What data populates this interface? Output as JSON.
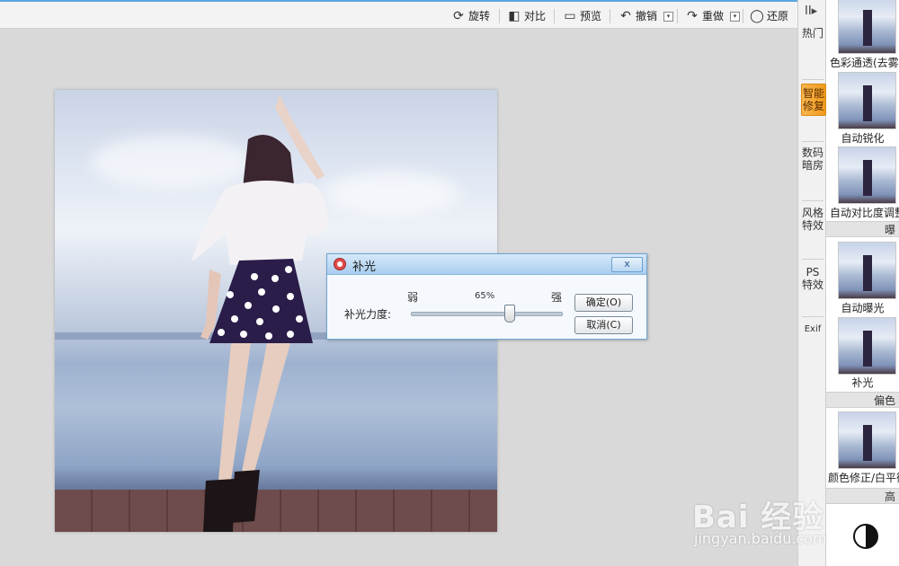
{
  "toolbar": {
    "rotate": "旋转",
    "compare": "对比",
    "preview": "预览",
    "undo": "撤销",
    "redo": "重做",
    "restore": "还原"
  },
  "dialog": {
    "title": "补光",
    "close": "x",
    "label": "补光力度:",
    "weak": "弱",
    "strong": "强",
    "value": "65%",
    "value_percent": 65,
    "ok": "确定(O)",
    "cancel": "取消(C)"
  },
  "tabs": {
    "collapse": "II▸",
    "items": [
      "热门",
      "智能修复",
      "数码暗房",
      "风格特效",
      "PS特效",
      "Exif"
    ],
    "active": "智能修复"
  },
  "panel": {
    "items": [
      {
        "label": "色彩通透(去雾"
      },
      {
        "label": "自动锐化"
      },
      {
        "label": "自动对比度调整"
      },
      {
        "label": "自动曝光"
      },
      {
        "label": "补光"
      },
      {
        "label": "颜色修正/白平衡"
      }
    ],
    "sections": [
      "曝",
      "偏色",
      "高"
    ]
  },
  "watermark": {
    "brand": "Bai 经验",
    "url": "jingyan.baidu.com"
  }
}
